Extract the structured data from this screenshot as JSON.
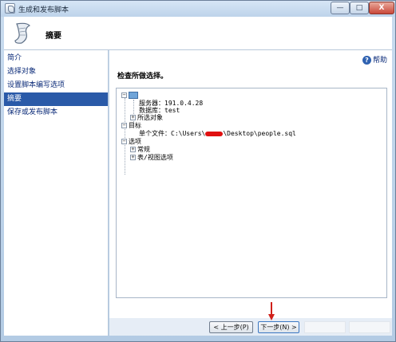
{
  "window": {
    "title": "生成和发布脚本",
    "controls": {
      "minimize": "—",
      "maximize": "□",
      "close": "X"
    }
  },
  "header": {
    "title": "摘要",
    "icon": "scroll-icon"
  },
  "nav": {
    "items": [
      {
        "label": "简介"
      },
      {
        "label": "选择对象"
      },
      {
        "label": "设置脚本编写选项"
      },
      {
        "label": "摘要",
        "active": true
      },
      {
        "label": "保存或发布脚本"
      }
    ]
  },
  "main": {
    "help": "帮助",
    "section_title": "检查所做选择。",
    "tree": {
      "server_label": "服务器：191.0.4.28",
      "database_label": "数据库：test",
      "selected_objects": "所选对象",
      "target": "目标",
      "single_file_prefix": "单个文件：C:\\Users\\",
      "single_file_suffix": "\\Desktop\\people.sql",
      "options": "选项",
      "general": "常规",
      "table_view_options": "表/视图选项"
    }
  },
  "buttons": {
    "prev": "< 上一步(P)",
    "next": "下一步(N) >"
  },
  "colors": {
    "nav_active": "#2a5aa8",
    "annotation_arrow": "#d0201a",
    "redaction": "#e01010"
  }
}
